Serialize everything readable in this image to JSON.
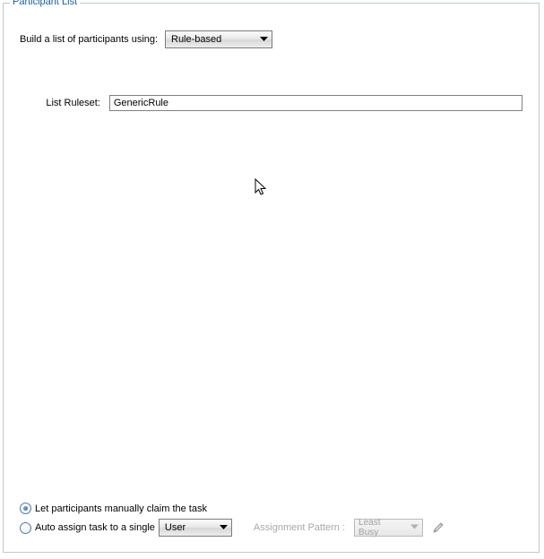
{
  "fieldset": {
    "title": "Participant List"
  },
  "build": {
    "label": "Build a list of participants using:",
    "value": "Rule-based"
  },
  "ruleset": {
    "label": "List Ruleset:",
    "value": "GenericRule"
  },
  "assignment": {
    "manual": {
      "label": "Let participants manually claim the task",
      "selected": true
    },
    "auto": {
      "label": "Auto assign task to a single",
      "selected": false,
      "target_value": "User"
    },
    "pattern": {
      "label": "Assignment Pattern :",
      "value": "Least Busy"
    }
  }
}
